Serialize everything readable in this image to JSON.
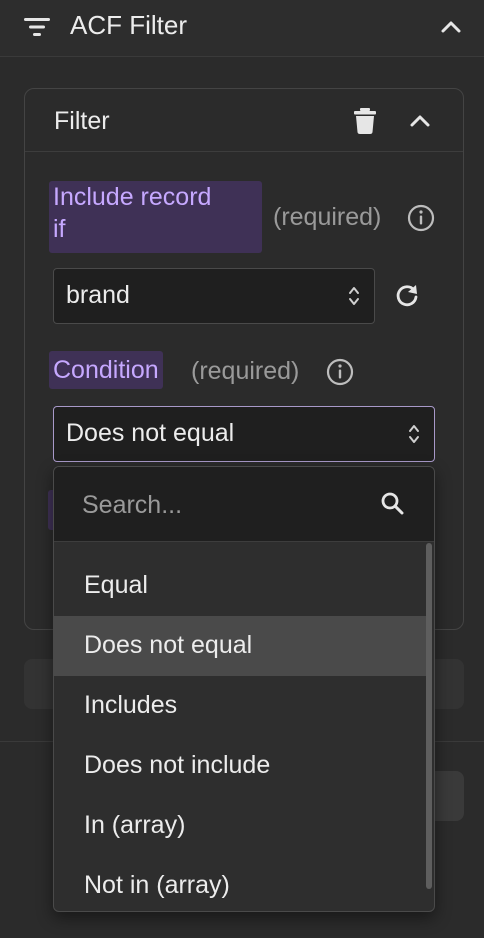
{
  "panel": {
    "title": "ACF Filter",
    "icons": {
      "filter": "filter-lines-icon",
      "collapse": "chevron-up-icon"
    }
  },
  "filter_card": {
    "title": "Filter",
    "icons": {
      "delete": "trash-icon",
      "collapse": "chevron-up-icon"
    },
    "include_field": {
      "label_line1": "Include record",
      "label_line2": "if",
      "required": "(required)",
      "value": "brand",
      "icons": {
        "info": "info-icon",
        "refresh": "refresh-icon"
      }
    },
    "condition_field": {
      "label": "Condition",
      "required": "(required)",
      "value": "Does not equal",
      "icons": {
        "info": "info-icon"
      }
    }
  },
  "dropdown": {
    "search_placeholder": "Search...",
    "options": [
      "Equal",
      "Does not equal",
      "Includes",
      "Does not include",
      "In (array)",
      "Not in (array)"
    ],
    "selected_index": 1,
    "icons": {
      "search": "search-icon"
    }
  },
  "colors": {
    "background": "#2b2b2b",
    "label_highlight_bg": "#3f3156",
    "label_highlight_text": "#c6a8ff",
    "focus_border": "#a899c9",
    "selected_option_bg": "#4a4a4a"
  }
}
